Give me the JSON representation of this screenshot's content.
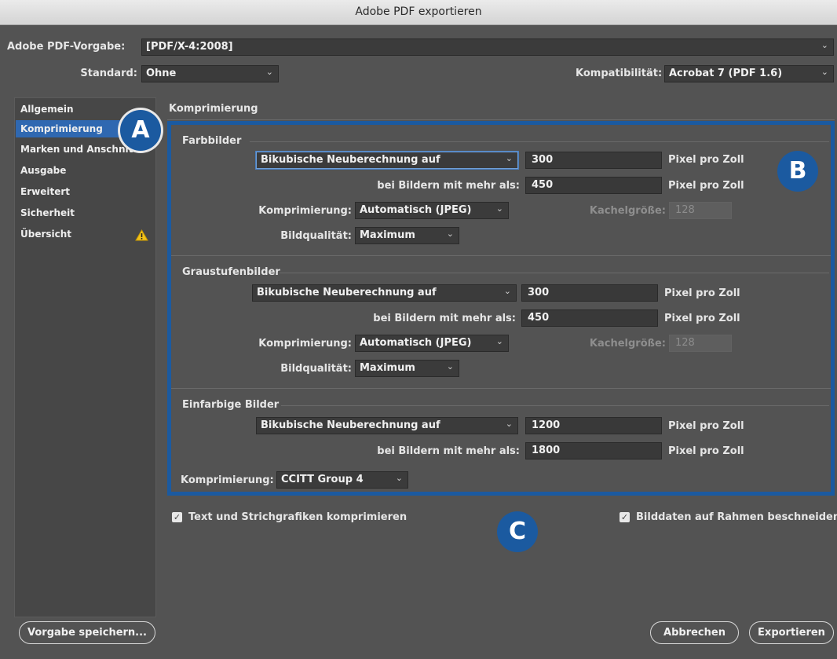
{
  "window": {
    "title": "Adobe PDF exportieren"
  },
  "header": {
    "preset_label": "Adobe PDF-Vorgabe:",
    "preset_value": "[PDF/X-4:2008]",
    "standard_label": "Standard:",
    "standard_value": "Ohne",
    "compat_label": "Kompatibilität:",
    "compat_value": "Acrobat 7 (PDF 1.6)"
  },
  "sidebar": {
    "items": [
      {
        "label": "Allgemein"
      },
      {
        "label": "Komprimierung"
      },
      {
        "label": "Marken und Anschnitt"
      },
      {
        "label": "Ausgabe"
      },
      {
        "label": "Erweitert"
      },
      {
        "label": "Sicherheit"
      },
      {
        "label": "Übersicht"
      }
    ]
  },
  "main": {
    "title": "Komprimierung",
    "color": {
      "heading": "Farbbilder",
      "resample": "Bikubische Neuberechnung auf",
      "ppi": "300",
      "unit": "Pixel pro Zoll",
      "above_label": "bei Bildern mit mehr als:",
      "above": "450",
      "compression_label": "Komprimierung:",
      "compression": "Automatisch (JPEG)",
      "tile_label": "Kachelgröße:",
      "tile": "128",
      "quality_label": "Bildqualität:",
      "quality": "Maximum"
    },
    "gray": {
      "heading": "Graustufenbilder",
      "resample": "Bikubische Neuberechnung auf",
      "ppi": "300",
      "unit": "Pixel pro Zoll",
      "above_label": "bei Bildern mit mehr als:",
      "above": "450",
      "compression_label": "Komprimierung:",
      "compression": "Automatisch (JPEG)",
      "tile_label": "Kachelgröße:",
      "tile": "128",
      "quality_label": "Bildqualität:",
      "quality": "Maximum"
    },
    "mono": {
      "heading": "Einfarbige Bilder",
      "resample": "Bikubische Neuberechnung auf",
      "ppi": "1200",
      "unit": "Pixel pro Zoll",
      "above_label": "bei Bildern mit mehr als:",
      "above": "1800",
      "compression_label": "Komprimierung:",
      "compression": "CCITT Group 4"
    },
    "compress_text_label": "Text und Strichgrafiken komprimieren",
    "crop_label": "Bilddaten auf Rahmen beschneiden"
  },
  "footer": {
    "save_preset": "Vorgabe speichern...",
    "cancel": "Abbrechen",
    "export": "Exportieren"
  },
  "badges": {
    "a": "A",
    "b": "B",
    "c": "C"
  },
  "icons": {
    "warning": "warning-icon",
    "dropdown": "chevron-down-icon",
    "check": "checkbox-checked-icon"
  },
  "colors": {
    "accent": "#1b5aa0",
    "selection": "#2f68b1",
    "background": "#535353"
  }
}
